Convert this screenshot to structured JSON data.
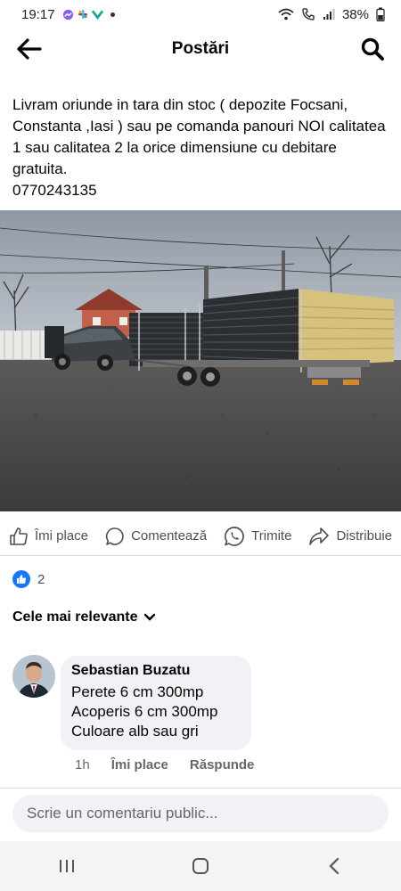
{
  "status_bar": {
    "time": "19:17",
    "battery": "38%"
  },
  "header": {
    "title": "Postări"
  },
  "post": {
    "paragraph": "Livram oriunde in tara din stoc ( depozite Focsani, Constanta ,Iasi ) sau pe comanda panouri NOI calitatea 1 sau calitatea 2 la orice dimensiune cu debitare gratuita.",
    "phone": "0770243135"
  },
  "actions": {
    "like": "Îmi place",
    "comment": "Comentează",
    "send": "Trimite",
    "share": "Distribuie"
  },
  "reactions": {
    "count": "2"
  },
  "sort": {
    "label": "Cele mai relevante"
  },
  "comment": {
    "author": "Sebastian Buzatu",
    "lines": [
      "Perete 6 cm 300mp",
      "Acoperis 6 cm 300mp",
      "Culoare alb sau gri"
    ],
    "time": "1h",
    "like_label": "Îmi place",
    "reply_label": "Răspunde"
  },
  "comment_input": {
    "placeholder": "Scrie un comentariu public..."
  },
  "colors": {
    "accent": "#1877f2",
    "text": "#050505",
    "muted": "#65676b",
    "bubble": "#f0f2f5"
  }
}
